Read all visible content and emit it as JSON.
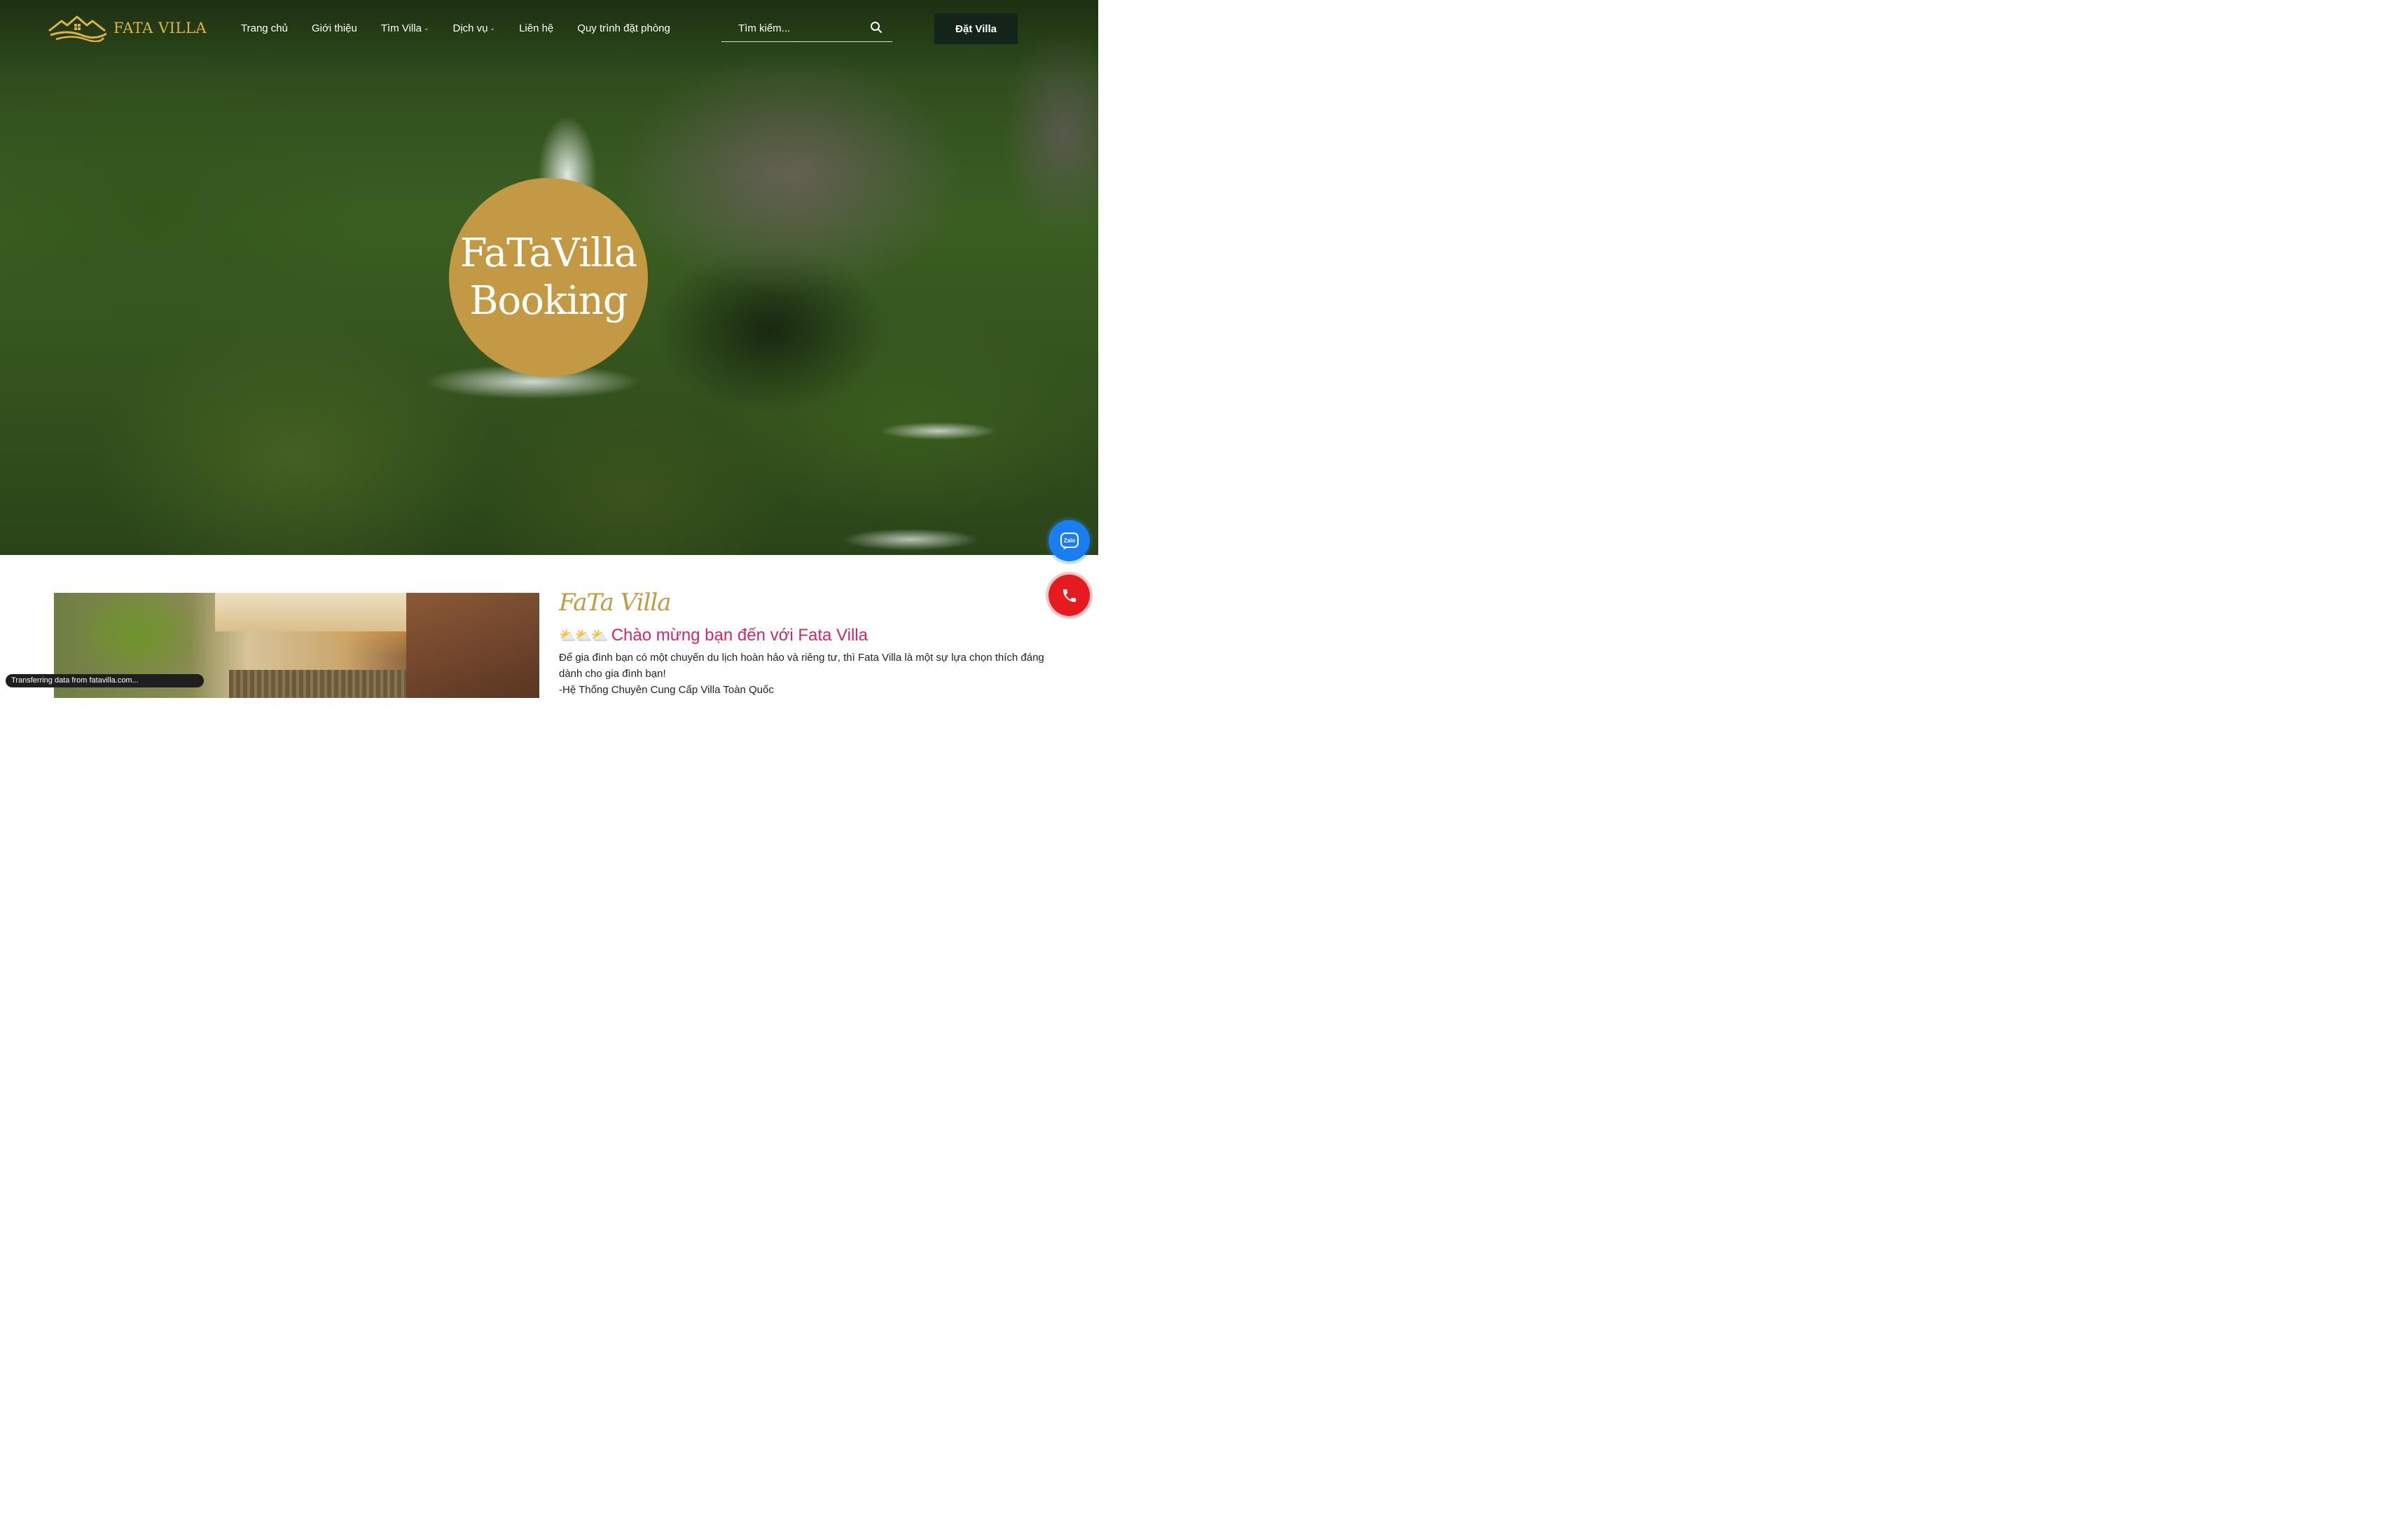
{
  "header": {
    "brand": "FATA VILLA",
    "nav": [
      {
        "label": "Trang chủ",
        "dropdown": false
      },
      {
        "label": "Giới thiệu",
        "dropdown": false
      },
      {
        "label": "Tìm Villa",
        "dropdown": true
      },
      {
        "label": "Dịch vụ",
        "dropdown": true
      },
      {
        "label": "Liên hệ",
        "dropdown": false
      },
      {
        "label": "Quy trình đặt phòng",
        "dropdown": false
      }
    ],
    "search": {
      "placeholder": "Tìm kiếm..."
    },
    "cta": "Đặt Villa"
  },
  "hero": {
    "line1": "FaTaVilla",
    "line2": "Booking",
    "circle_color": "#c39a43"
  },
  "floating": {
    "zalo_label": "Zalo",
    "zalo_color": "#1b7ef0",
    "phone_color": "#e61b20"
  },
  "intro": {
    "script_title": "FaTa Villa",
    "emoji": "⛅⛅⛅",
    "heading": "Chào mừng bạn đến với Fata Villa",
    "paragraph": "Để gia đình bạn có một chuyến du lịch hoàn hảo và riêng tư, thì Fata Villa là một sự lựa chọn thích đáng dành cho gia đình bạn!",
    "tagline": "-Hệ Thống Chuyên Cung Cấp Villa Toàn Quốc"
  },
  "status": "Transferring data from fatavilla.com...",
  "colors": {
    "gold": "#c39a43",
    "pink": "#d0266b",
    "dark_green": "#142418"
  }
}
